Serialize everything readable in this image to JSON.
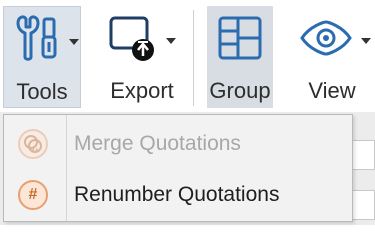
{
  "ribbon": {
    "tools": {
      "label": "Tools",
      "icon": "tools-icon"
    },
    "export": {
      "label": "Export",
      "icon": "export-icon"
    },
    "group": {
      "label": "Group",
      "icon": "group-icon"
    },
    "view": {
      "label": "View",
      "icon": "eye-icon"
    }
  },
  "tools_menu": {
    "items": [
      {
        "label": "Merge Quotations",
        "icon": "merge-quotations-icon",
        "enabled": false
      },
      {
        "label": "Renumber Quotations",
        "icon": "renumber-quotations-icon",
        "enabled": true
      }
    ]
  },
  "colors": {
    "accent_blue": "#2b6cb0",
    "menu_icon_orange": "#e8a070"
  }
}
